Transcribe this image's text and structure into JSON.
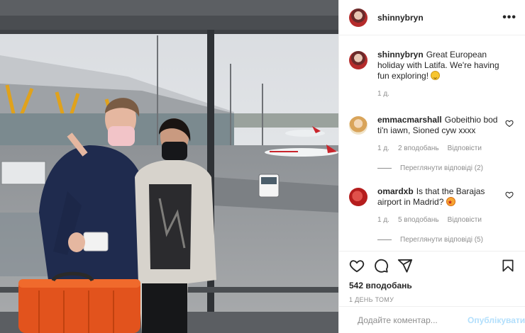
{
  "post": {
    "username": "shinnybryn",
    "more_icon": "more-horizontal-icon",
    "caption": {
      "username": "shinnybryn",
      "text": "Great European holiday with Latifa. We're having fun exploring!",
      "emoji": "smiling-face-emoji",
      "time": "1 д."
    },
    "comments": [
      {
        "username": "emmacmarshall",
        "text": "Gobeithio bod ti'n iawn, Sioned cyw xxxx",
        "time": "1 д.",
        "likes": "2 вподобань",
        "reply_label": "Відповісти",
        "replies_label": "Переглянути відповіді (2)"
      },
      {
        "username": "omardxb",
        "text": "Is that the Barajas airport in Madrid?",
        "emoji": "star-struck-emoji",
        "time": "1 д.",
        "likes": "5 вподобань",
        "reply_label": "Відповісти",
        "replies_label": "Переглянути відповіді (5)"
      }
    ],
    "likes_count": "542 вподобань",
    "posted_ago": "1 ДЕНЬ ТОМУ",
    "comment_placeholder": "Додайте коментар...",
    "publish_label": "Опублікувати",
    "icons": [
      "heart-icon",
      "comment-icon",
      "share-icon",
      "bookmark-icon",
      "emoji-icon"
    ],
    "colors": {
      "text": "#262626",
      "muted": "#8e8e8e",
      "publish_disabled": "#b2dffc",
      "border": "#efefef"
    }
  }
}
